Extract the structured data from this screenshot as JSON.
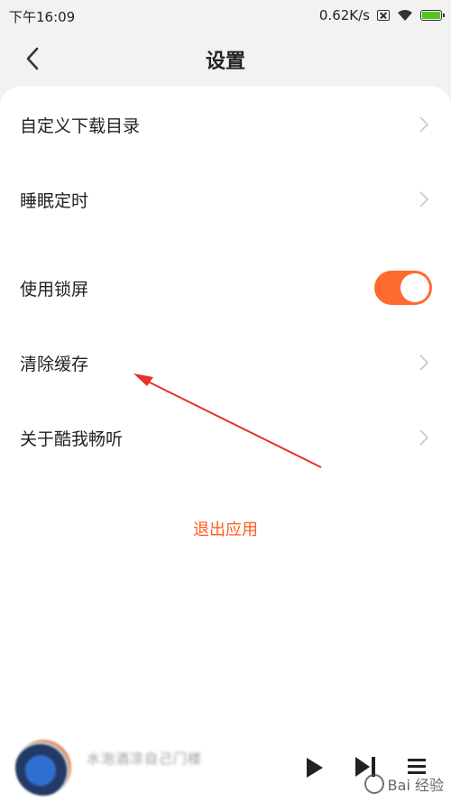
{
  "status_bar": {
    "time": "下午16:09",
    "network_speed": "0.62K/s",
    "battery_level": 1.0
  },
  "header": {
    "title": "设置"
  },
  "settings": {
    "items": [
      {
        "label": "自定义下载目录",
        "type": "link"
      },
      {
        "label": "睡眠定时",
        "type": "link"
      },
      {
        "label": "使用锁屏",
        "type": "toggle",
        "enabled": true
      },
      {
        "label": "清除缓存",
        "type": "link"
      },
      {
        "label": "关于酷我畅听",
        "type": "link"
      }
    ],
    "logout_label": "退出应用"
  },
  "player": {
    "song_title": "水泡酒凉自己门楼"
  },
  "watermark": {
    "text": "Bai 经验"
  },
  "colors": {
    "accent": "#ff6a2f",
    "logout": "#ff5b1f",
    "annotation_arrow": "#e8312a"
  }
}
